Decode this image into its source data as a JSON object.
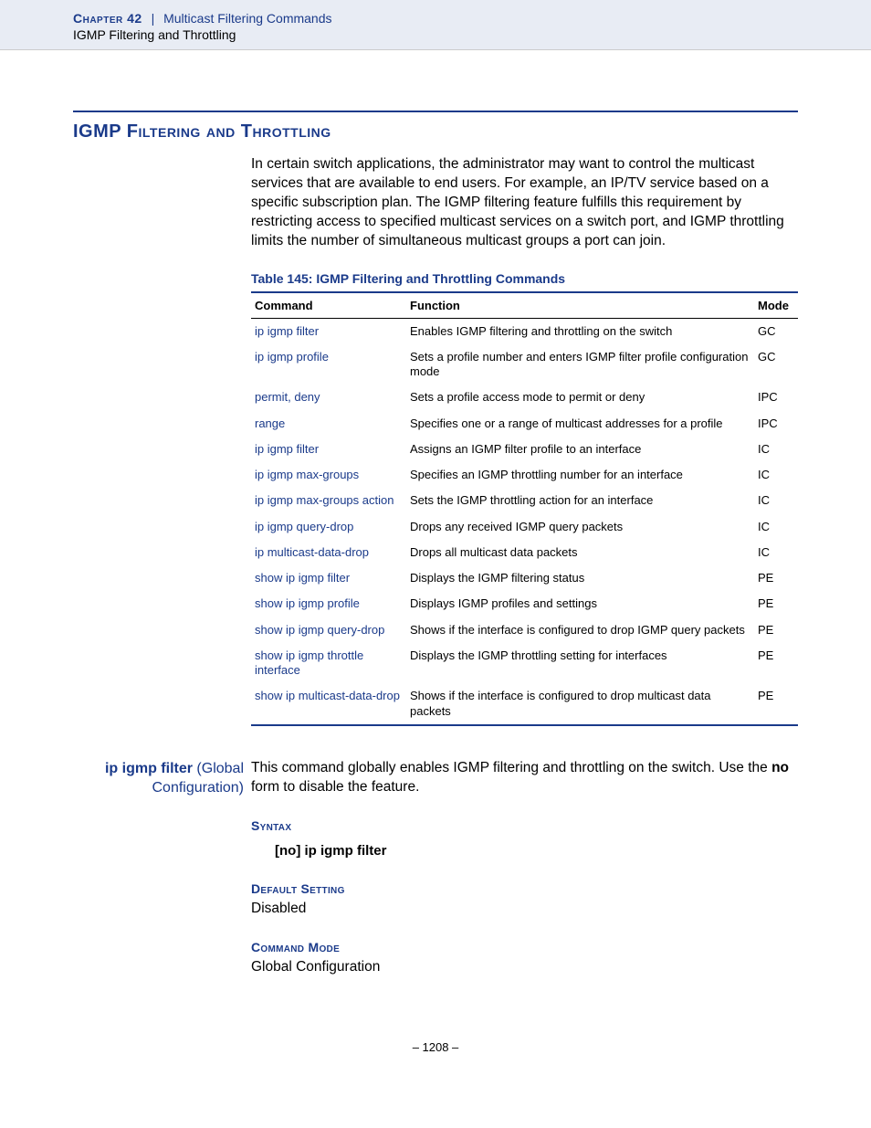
{
  "header": {
    "chapter_label": "Chapter 42",
    "separator": "|",
    "chapter_title": "Multicast Filtering Commands",
    "subsection": "IGMP Filtering and Throttling"
  },
  "section_title_prefix": "IGMP F",
  "section_title_mid": "iltering and",
  "section_title_suffix": " Throttling",
  "intro": "In certain switch applications, the administrator may want to control the multicast services that are available to end users. For example, an IP/TV service based on a specific subscription plan. The IGMP filtering feature fulfills this requirement by restricting access to specified multicast services on a switch port, and IGMP throttling limits the number of simultaneous multicast groups a port can join.",
  "table_caption": "Table 145: IGMP Filtering and Throttling Commands",
  "columns": {
    "c1": "Command",
    "c2": "Function",
    "c3": "Mode"
  },
  "rows": [
    {
      "cmd": "ip igmp filter",
      "fn": "Enables IGMP filtering and throttling on the switch",
      "mode": "GC"
    },
    {
      "cmd": "ip igmp profile",
      "fn": "Sets a profile number and enters IGMP filter profile configuration mode",
      "mode": "GC"
    },
    {
      "cmd": "permit, deny",
      "fn": "Sets a profile access mode to permit or deny",
      "mode": "IPC"
    },
    {
      "cmd": "range",
      "fn": "Specifies one or a range of multicast addresses for a profile",
      "mode": "IPC"
    },
    {
      "cmd": "ip igmp filter",
      "fn": "Assigns an IGMP filter profile to an interface",
      "mode": "IC"
    },
    {
      "cmd": "ip igmp max-groups",
      "fn": "Specifies an IGMP throttling number for an interface",
      "mode": "IC"
    },
    {
      "cmd": "ip igmp max-groups action",
      "fn": "Sets the IGMP throttling action for an interface",
      "mode": "IC"
    },
    {
      "cmd": "ip igmp query-drop",
      "fn": "Drops any received IGMP query packets",
      "mode": "IC"
    },
    {
      "cmd": "ip multicast-data-drop",
      "fn": "Drops all multicast data packets",
      "mode": "IC"
    },
    {
      "cmd": "show ip igmp filter",
      "fn": "Displays the IGMP filtering status",
      "mode": "PE"
    },
    {
      "cmd": "show ip igmp profile",
      "fn": "Displays IGMP profiles and settings",
      "mode": "PE"
    },
    {
      "cmd": "show ip igmp query-drop",
      "fn": "Shows if the interface is configured to drop IGMP query packets",
      "mode": "PE"
    },
    {
      "cmd": "show ip igmp throttle interface",
      "fn": "Displays the IGMP throttling setting for interfaces",
      "mode": "PE"
    },
    {
      "cmd": "show ip multicast-data-drop",
      "fn": "Shows if the interface is configured to drop multicast data packets",
      "mode": "PE"
    }
  ],
  "entry": {
    "label_bold": "ip igmp filter",
    "label_rest": " (Global Configuration)",
    "desc_pre": "This command globally enables IGMP filtering and throttling on the switch. Use the ",
    "desc_bold": "no",
    "desc_post": " form to disable the feature.",
    "syntax_head": "Syntax",
    "syntax_line": "[no] ip igmp filter",
    "default_head": "Default Setting",
    "default_val": "Disabled",
    "mode_head": "Command Mode",
    "mode_val": "Global Configuration"
  },
  "page_number": "–  1208  –"
}
